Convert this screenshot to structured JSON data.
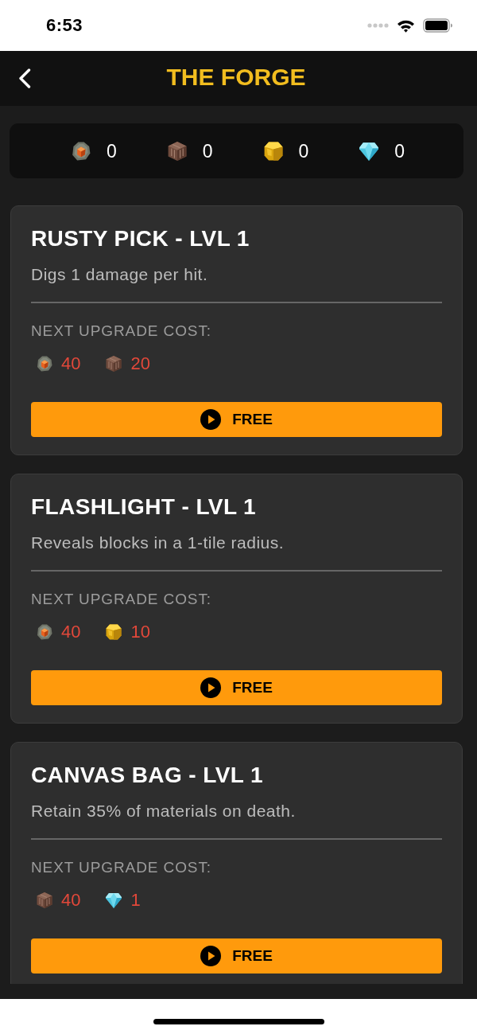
{
  "status_bar": {
    "time": "6:53"
  },
  "header": {
    "title": "THE FORGE"
  },
  "resources": [
    {
      "kind": "ore",
      "value": "0"
    },
    {
      "kind": "block",
      "value": "0"
    },
    {
      "kind": "nugget",
      "value": "0"
    },
    {
      "kind": "gem",
      "value": "0"
    }
  ],
  "upgrades": [
    {
      "title": "RUSTY PICK - LVL 1",
      "description": "Digs 1 damage per hit.",
      "cost_label": "NEXT UPGRADE COST:",
      "costs": [
        {
          "kind": "ore",
          "amount": "40",
          "affordable": false
        },
        {
          "kind": "block",
          "amount": "20",
          "affordable": false
        }
      ],
      "button": "FREE"
    },
    {
      "title": "FLASHLIGHT - LVL 1",
      "description": "Reveals blocks in a 1-tile radius.",
      "cost_label": "NEXT UPGRADE COST:",
      "costs": [
        {
          "kind": "ore",
          "amount": "40",
          "affordable": false
        },
        {
          "kind": "nugget",
          "amount": "10",
          "affordable": false
        }
      ],
      "button": "FREE"
    },
    {
      "title": "CANVAS BAG - LVL 1",
      "description": "Retain 35% of materials on death.",
      "cost_label": "NEXT UPGRADE COST:",
      "costs": [
        {
          "kind": "block",
          "amount": "40",
          "affordable": false
        },
        {
          "kind": "gem",
          "amount": "1",
          "affordable": false
        }
      ],
      "button": "FREE"
    }
  ]
}
